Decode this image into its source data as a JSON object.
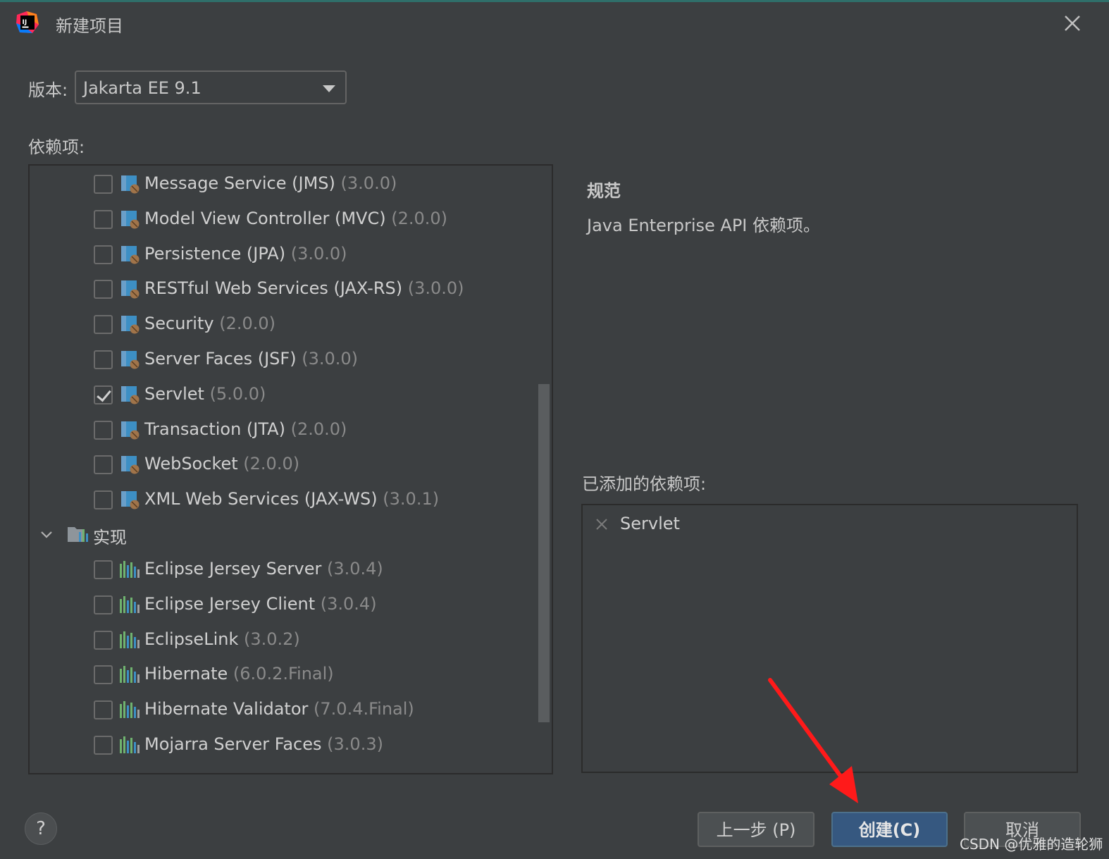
{
  "window": {
    "title": "新建项目",
    "close_icon": "close-icon",
    "app_icon": "intellij-idea-icon"
  },
  "version": {
    "label": "版本:",
    "value": "Jakarta EE 9.1"
  },
  "dependencies": {
    "label": "依赖项:",
    "specs": [
      {
        "name": "Message Service (JMS)",
        "version": "(3.0.0)",
        "checked": false
      },
      {
        "name": "Model View Controller (MVC)",
        "version": "(2.0.0)",
        "checked": false
      },
      {
        "name": "Persistence (JPA)",
        "version": "(3.0.0)",
        "checked": false
      },
      {
        "name": "RESTful Web Services (JAX-RS)",
        "version": "(3.0.0)",
        "checked": false
      },
      {
        "name": "Security",
        "version": "(2.0.0)",
        "checked": false
      },
      {
        "name": "Server Faces (JSF)",
        "version": "(3.0.0)",
        "checked": false
      },
      {
        "name": "Servlet",
        "version": "(5.0.0)",
        "checked": true
      },
      {
        "name": "Transaction (JTA)",
        "version": "(2.0.0)",
        "checked": false
      },
      {
        "name": "WebSocket",
        "version": "(2.0.0)",
        "checked": false
      },
      {
        "name": "XML Web Services (JAX-WS)",
        "version": "(3.0.1)",
        "checked": false
      }
    ],
    "impl_group": {
      "label": "实现",
      "expanded": true
    },
    "impls": [
      {
        "name": "Eclipse Jersey Server",
        "version": "(3.0.4)",
        "checked": false
      },
      {
        "name": "Eclipse Jersey Client",
        "version": "(3.0.4)",
        "checked": false
      },
      {
        "name": "EclipseLink",
        "version": "(3.0.2)",
        "checked": false
      },
      {
        "name": "Hibernate",
        "version": "(6.0.2.Final)",
        "checked": false
      },
      {
        "name": "Hibernate Validator",
        "version": "(7.0.4.Final)",
        "checked": false
      },
      {
        "name": "Mojarra Server Faces",
        "version": "(3.0.3)",
        "checked": false
      }
    ]
  },
  "spec_info": {
    "title": "规范",
    "description": "Java Enterprise API 依赖项。"
  },
  "added": {
    "label": "已添加的依赖项:",
    "items": [
      "Servlet"
    ]
  },
  "buttons": {
    "help": "?",
    "previous": "上一步 (P)",
    "create": "创建(C)",
    "cancel": "取消"
  },
  "watermark": "CSDN @优雅的造轮狮",
  "colors": {
    "accent": "#365880",
    "arrow": "#ff1a1a",
    "module_icon": "#3d8fc4",
    "library_icon": "#6fb36f"
  }
}
